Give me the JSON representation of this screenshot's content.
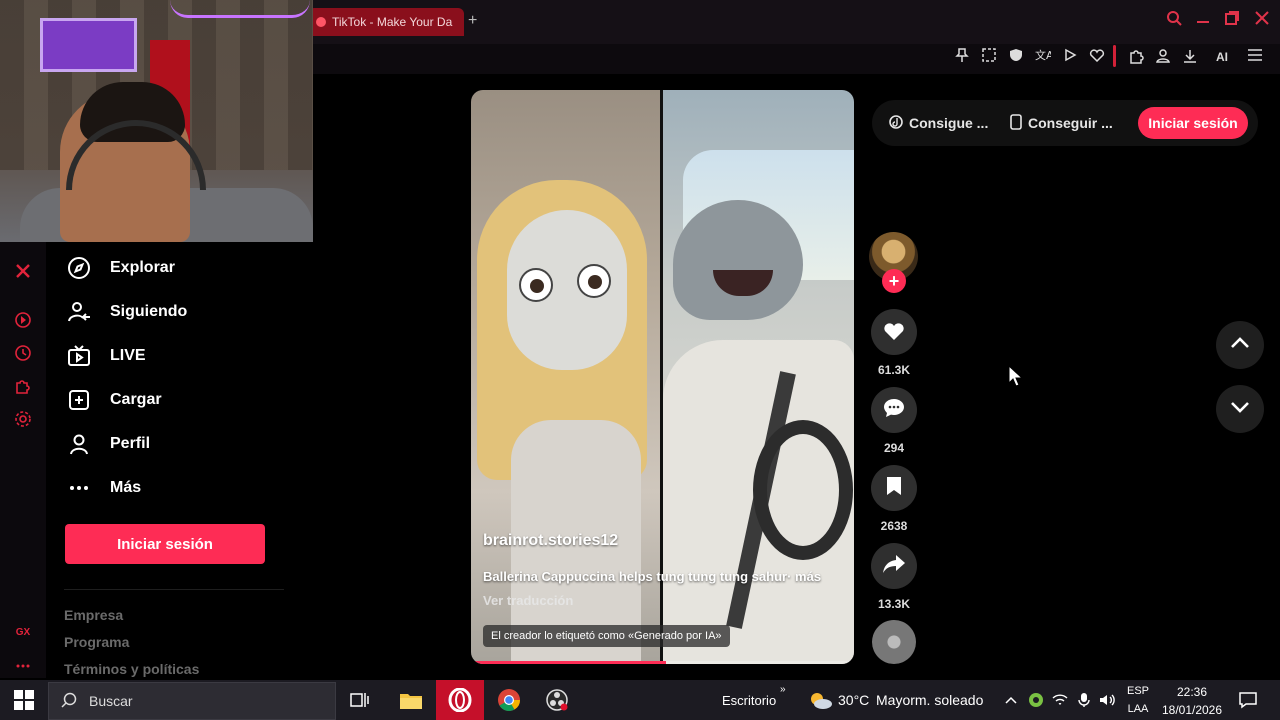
{
  "browser": {
    "tab_title": "TikTok - Make Your Da",
    "new_tab_symbol": "+",
    "toolbar_ai_label": "AI",
    "accent_color": "#fe2c55"
  },
  "sidebar": {
    "items": [
      {
        "label": "Explorar",
        "icon": "compass-icon"
      },
      {
        "label": "Siguiendo",
        "icon": "following-icon"
      },
      {
        "label": "LIVE",
        "icon": "live-tv-icon"
      },
      {
        "label": "Cargar",
        "icon": "upload-icon"
      },
      {
        "label": "Perfil",
        "icon": "profile-icon"
      },
      {
        "label": "Más",
        "icon": "more-icon"
      }
    ],
    "login_label": "Iniciar sesión",
    "footer_links": [
      "Empresa",
      "Programa",
      "Términos y políticas"
    ]
  },
  "video": {
    "username": "brainrot.stories12",
    "description": "Ballerina Cappuccina helps tung tung tung sahur·",
    "more_label": "más",
    "translate_label": "Ver traducción",
    "ai_label": "El creador lo etiquetó como «Generado por IA»",
    "progress": 0.51
  },
  "actions": {
    "likes": "61.3K",
    "comments": "294",
    "saves": "2638",
    "shares": "13.3K"
  },
  "header": {
    "get_coins_label": "Consigue ...",
    "get_app_label": "Conseguir ...",
    "login_label": "Iniciar sesión"
  },
  "taskbar": {
    "search_placeholder": "Buscar",
    "desktop_label": "Escritorio",
    "weather_temp": "30°C",
    "weather_desc": "Mayorm. soleado",
    "lang_top": "ESP",
    "lang_bottom": "LAA",
    "time": "22:36",
    "date": "18/01/2026"
  }
}
